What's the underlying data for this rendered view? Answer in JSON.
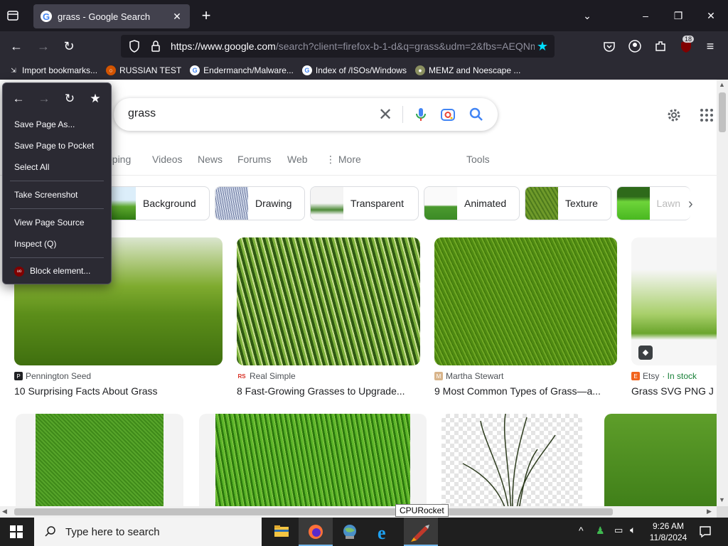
{
  "browser": {
    "tab_title": "grass - Google Search",
    "url_host": "https://www.google.com",
    "url_rest": "/search?client=firefox-b-1-d&q=grass&udm=2&fbs=AEQNm",
    "extension_badge": "18",
    "bookmarks": [
      {
        "label": "Import bookmarks...",
        "icon": "import-icon"
      },
      {
        "label": "RUSSIAN TEST",
        "icon": "github-icon"
      },
      {
        "label": "Endermanch/Malware...",
        "icon": "google-icon"
      },
      {
        "label": "Index of /ISOs/Windows",
        "icon": "google-icon"
      },
      {
        "label": "MEMZ and Noescape ...",
        "icon": "site-icon"
      }
    ]
  },
  "search": {
    "query": "grass",
    "tabs": [
      "pping",
      "Videos",
      "News",
      "Forums",
      "Web",
      "⋮ More"
    ],
    "tools": "Tools",
    "chips": [
      "Background",
      "Drawing",
      "Transparent",
      "Animated",
      "Texture",
      "Lawn"
    ]
  },
  "results": [
    {
      "source": "Pennington Seed",
      "title": "10 Surprising Facts About Grass"
    },
    {
      "source": "Real Simple",
      "title": "8 Fast-Growing Grasses to Upgrade..."
    },
    {
      "source": "Martha Stewart",
      "title": "9 Most Common Types of Grass—a..."
    },
    {
      "source": "Etsy",
      "stock": "· In stock",
      "title": "Grass SVG PNG J"
    }
  ],
  "context_menu": {
    "items": [
      "Save Page As...",
      "Save Page to Pocket",
      "Select All",
      "Take Screenshot",
      "View Page Source",
      "Inspect (Q)",
      "Block element..."
    ]
  },
  "tooltip": "CPURocket",
  "taskbar": {
    "search_placeholder": "Type here to search",
    "time": "9:26 AM",
    "date": "11/8/2024"
  },
  "colors": {
    "chrome_dark": "#1c1b22",
    "chrome_mid": "#2b2a33",
    "google_blue": "#4285f4",
    "accent_cyan": "#00ddff"
  }
}
